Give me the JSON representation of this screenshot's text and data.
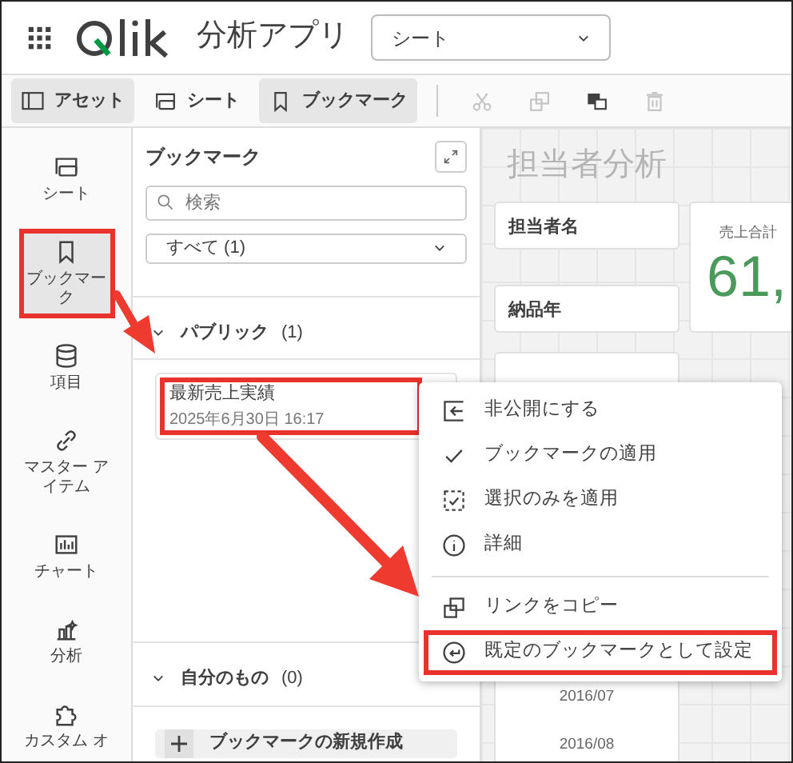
{
  "header": {
    "app_title": "分析アプリ",
    "sheet_select": "シート"
  },
  "toolbar": [
    {
      "label": "アセット",
      "selected": true
    },
    {
      "label": "シート",
      "selected": false
    },
    {
      "label": "ブックマーク",
      "selected": true
    }
  ],
  "toolbar_icons": [
    {
      "disabled": true
    },
    {
      "disabled": true
    },
    {
      "disabled": false
    },
    {
      "disabled": true
    }
  ],
  "rail": [
    {
      "label": "シート",
      "selected": false,
      "highlighted": false
    },
    {
      "label": "ブックマーク",
      "selected": true,
      "highlighted": true
    },
    {
      "label": "項目",
      "selected": false,
      "highlighted": false
    },
    {
      "label": "マスター アイテム",
      "selected": false,
      "highlighted": false
    },
    {
      "label": "チャート",
      "selected": false,
      "highlighted": false
    },
    {
      "label": "分析",
      "selected": false,
      "highlighted": false
    },
    {
      "label": "カスタム オ",
      "selected": false,
      "highlighted": false
    }
  ],
  "panel": {
    "title": "ブックマーク",
    "search_placeholder": "検索",
    "filter": "すべて (1)",
    "sections": [
      {
        "title": "パブリック",
        "count": "(1)",
        "expanded": true,
        "bookmarks": [
          {
            "name": "最新売上実績",
            "date": "2025年6月30日 16:17",
            "highlighted": true
          }
        ]
      },
      {
        "title": "自分のもの",
        "count": "(0)",
        "expanded": true
      }
    ],
    "create_button": "ブックマークの新規作成"
  },
  "sheet": {
    "title": "担当者分析",
    "filters": [
      "担当者名",
      "納品年"
    ],
    "kpi": {
      "label": "売上合計",
      "value": "61,"
    },
    "dates": [
      "2016/07",
      "2016/08"
    ]
  },
  "context_menu": [
    {
      "label": "非公開にする",
      "separator_before": false,
      "highlighted": false
    },
    {
      "label": "ブックマークの適用",
      "separator_before": false,
      "highlighted": false
    },
    {
      "label": "選択のみを適用",
      "separator_before": false,
      "highlighted": false
    },
    {
      "label": "詳細",
      "separator_before": false,
      "highlighted": false
    },
    {
      "label": "リンクをコピー",
      "separator_before": true,
      "highlighted": false
    },
    {
      "label": "既定のブックマークとして設定",
      "separator_before": false,
      "highlighted": true
    }
  ]
}
